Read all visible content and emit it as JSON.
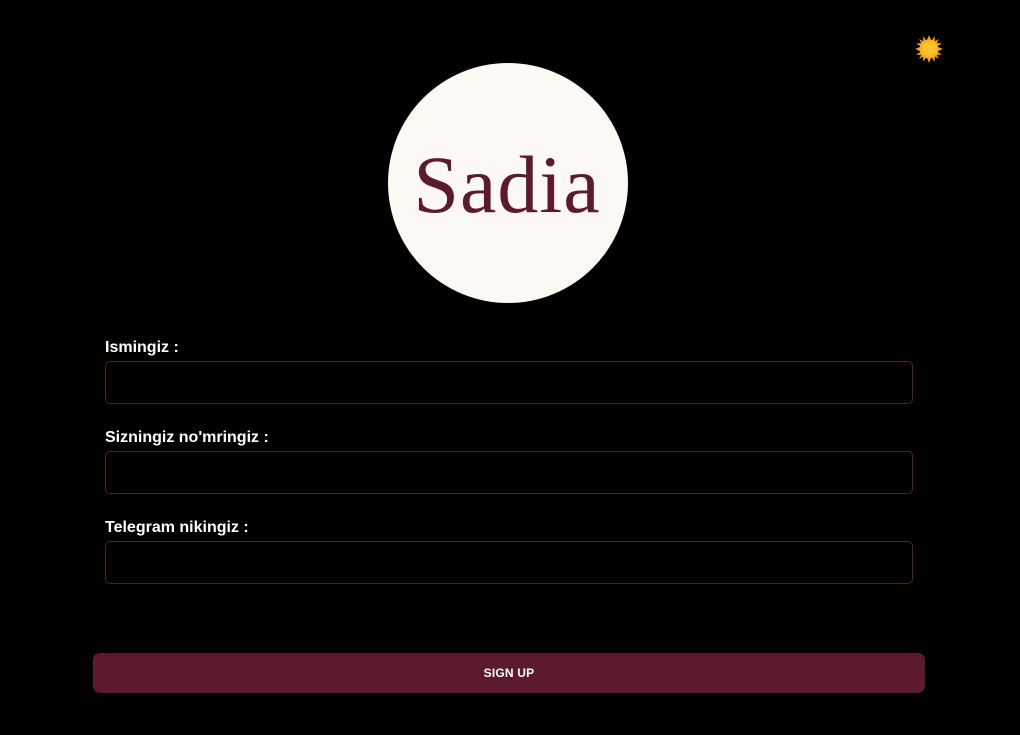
{
  "header": {
    "theme_toggle_icon": "sun-icon"
  },
  "logo": {
    "text": "Sadia",
    "text_color": "#5c1a2d",
    "background_color": "#fcf8f4"
  },
  "form": {
    "fields": [
      {
        "label": "Ismingiz :",
        "value": "",
        "placeholder": ""
      },
      {
        "label": "Sizningiz no'mringiz :",
        "value": "",
        "placeholder": ""
      },
      {
        "label": "Telegram nikingiz :",
        "value": "",
        "placeholder": ""
      }
    ],
    "submit_label": "SIGN UP"
  },
  "colors": {
    "background": "#000000",
    "accent": "#5c1a2d",
    "input_border": "#5c1a2c",
    "label_text": "#ffffff",
    "sun": "#f5a60f"
  }
}
